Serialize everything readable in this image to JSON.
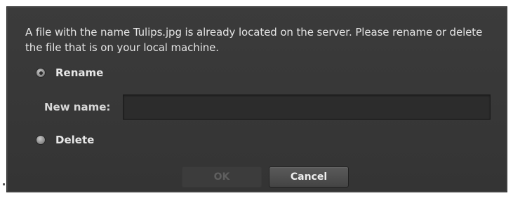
{
  "dialog": {
    "message": "A file with the name Tulips.jpg is already located on the server. Please rename or delete the file that is on your local machine.",
    "options": {
      "rename_label": "Rename",
      "delete_label": "Delete",
      "selected": "Rename"
    },
    "new_name": {
      "label": "New name:",
      "value": ""
    },
    "buttons": {
      "ok_label": "OK",
      "cancel_label": "Cancel",
      "ok_enabled": false
    }
  }
}
